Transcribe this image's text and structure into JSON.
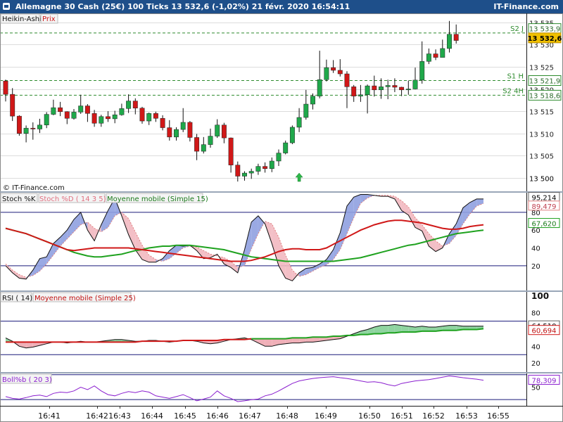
{
  "header": {
    "title": "Allemagne 30 Cash (25€)   100 Ticks   13 532,6 (-1,02%)   21 févr. 2020 16:54:11",
    "brand": "IT-Finance.com"
  },
  "watermark": "© IT-Finance.com",
  "colors": {
    "bull": "#1fa84a",
    "bear": "#d01818",
    "grid": "#dcdcdc",
    "sep": "#1a1a1a",
    "dash": "#2e8b2e",
    "k": "#111111",
    "d": "#e08080",
    "ma_stoch": "#1fa21f",
    "rsi": "#111111",
    "rsi_ma": "#d01818",
    "boll": "#8a1ecf",
    "fill_up": "#8fa0e0",
    "fill_down": "#f2b8c0",
    "fill_rsi_up": "#8fd4a0",
    "fill_rsi_down": "#f0b0b8",
    "hline": "#1a1a7a"
  },
  "chart_data": [
    {
      "type": "candlestick",
      "subtype": "heikin-ashi",
      "legend": [
        "Heikin-Ashi",
        "Prix"
      ],
      "ylim": [
        13497,
        13537
      ],
      "yticks": [
        13500,
        13505,
        13510,
        13515,
        13520,
        13525,
        13530,
        13535
      ],
      "xticks": [
        "16:41",
        "16:42",
        "16:43",
        "16:44",
        "16:45",
        "16:46",
        "16:47",
        "16:48",
        "16:49",
        "16:50",
        "16:51",
        "16:52",
        "16:53",
        "16:55"
      ],
      "levels": [
        {
          "label": "S2 J",
          "value": 13532.6
        },
        {
          "label": "S1 H",
          "value": 13521.9
        },
        {
          "label": "S2 4H",
          "value": 13518.6
        }
      ],
      "price_labels": [
        "13 533,9",
        "13 532,6",
        "13 521,9",
        "13 518,6"
      ],
      "signal": "buy-arrow",
      "candles": [
        [
          13521.8,
          13518.8,
          13522.1,
          13517.2
        ],
        [
          13518.8,
          13513.9,
          13520.2,
          13512.8
        ],
        [
          13513.9,
          13510.0,
          13514.1,
          13509.5
        ],
        [
          13510.0,
          13511.2,
          13511.8,
          13508.0
        ],
        [
          13511.2,
          13511.0,
          13512.5,
          13508.6
        ],
        [
          13511.0,
          13511.9,
          13513.3,
          13510.1
        ],
        [
          13511.9,
          13514.3,
          13514.8,
          13511.2
        ],
        [
          13514.3,
          13515.8,
          13517.6,
          13514.1
        ],
        [
          13515.8,
          13514.9,
          13517.1,
          13513.9
        ],
        [
          13514.9,
          13513.4,
          13515.0,
          13512.1
        ],
        [
          13513.4,
          13514.8,
          13515.5,
          13513.1
        ],
        [
          13514.8,
          13516.2,
          13518.7,
          13514.4
        ],
        [
          13516.2,
          13514.5,
          13516.6,
          13512.6
        ],
        [
          13514.5,
          13512.3,
          13515.3,
          13511.5
        ],
        [
          13512.3,
          13513.8,
          13514.2,
          13511.5
        ],
        [
          13513.8,
          13513.3,
          13515.0,
          13512.6
        ],
        [
          13513.3,
          13514.2,
          13515.1,
          13512.3
        ],
        [
          13514.2,
          13515.6,
          13516.7,
          13514.0
        ],
        [
          13515.6,
          13517.3,
          13518.8,
          13514.6
        ],
        [
          13517.3,
          13515.7,
          13517.9,
          13514.3
        ],
        [
          13515.7,
          13512.8,
          13516.0,
          13512.2
        ],
        [
          13512.8,
          13514.5,
          13514.7,
          13511.9
        ],
        [
          13514.5,
          13513.4,
          13514.9,
          13512.6
        ],
        [
          13513.4,
          13511.3,
          13514.1,
          13510.7
        ],
        [
          13511.3,
          13509.2,
          13513.0,
          13508.4
        ],
        [
          13509.2,
          13510.9,
          13511.4,
          13508.4
        ],
        [
          13510.9,
          13512.5,
          13515.7,
          13510.3
        ],
        [
          13512.5,
          13509.1,
          13512.8,
          13508.2
        ],
        [
          13509.1,
          13506.0,
          13509.9,
          13504.0
        ],
        [
          13506.0,
          13507.5,
          13509.2,
          13505.5
        ],
        [
          13507.5,
          13509.4,
          13511.1,
          13506.8
        ],
        [
          13509.4,
          13511.9,
          13513.2,
          13509.0
        ],
        [
          13511.9,
          13509.0,
          13512.4,
          13507.8
        ],
        [
          13509.0,
          13502.9,
          13509.1,
          13501.2
        ],
        [
          13502.9,
          13500.4,
          13503.7,
          13499.2
        ],
        [
          13500.4,
          13501.1,
          13501.5,
          13499.4
        ],
        [
          13501.1,
          13501.5,
          13502.1,
          13499.8
        ],
        [
          13501.5,
          13502.6,
          13503.2,
          13500.7
        ],
        [
          13502.6,
          13502.1,
          13503.5,
          13501.2
        ],
        [
          13502.1,
          13503.8,
          13504.6,
          13501.3
        ],
        [
          13503.8,
          13505.6,
          13506.4,
          13502.7
        ],
        [
          13505.6,
          13507.9,
          13508.4,
          13505.3
        ],
        [
          13507.9,
          13511.4,
          13511.8,
          13507.6
        ],
        [
          13511.4,
          13513.6,
          13515.7,
          13510.3
        ],
        [
          13513.6,
          13516.6,
          13519.8,
          13513.1
        ],
        [
          13516.6,
          13518.4,
          13519.0,
          13515.4
        ],
        [
          13518.4,
          13522.1,
          13528.6,
          13517.9
        ],
        [
          13522.1,
          13524.8,
          13526.6,
          13521.7
        ],
        [
          13524.8,
          13524.2,
          13526.5,
          13523.6
        ],
        [
          13524.2,
          13523.4,
          13526.7,
          13522.8
        ],
        [
          13523.4,
          13520.5,
          13524.0,
          13515.7
        ],
        [
          13520.5,
          13518.4,
          13520.9,
          13517.1
        ],
        [
          13518.4,
          13518.7,
          13520.9,
          13517.1
        ],
        [
          13518.7,
          13520.7,
          13521.0,
          13514.5
        ],
        [
          13520.7,
          13519.8,
          13523.0,
          13518.3
        ],
        [
          13519.8,
          13520.5,
          13522.4,
          13517.8
        ],
        [
          13520.5,
          13520.8,
          13522.1,
          13517.7
        ],
        [
          13520.8,
          13520.4,
          13522.4,
          13519.3
        ],
        [
          13520.4,
          13519.8,
          13520.5,
          13518.4
        ],
        [
          13519.8,
          13520.0,
          13521.9,
          13518.7
        ],
        [
          13520.0,
          13522.0,
          13524.8,
          13519.9
        ],
        [
          13522.0,
          13526.2,
          13530.7,
          13521.2
        ],
        [
          13526.2,
          13527.9,
          13529.1,
          13525.6
        ],
        [
          13527.9,
          13527.1,
          13528.9,
          13526.5
        ],
        [
          13527.1,
          13529.1,
          13531.1,
          13527.1
        ],
        [
          13529.1,
          13532.3,
          13535.3,
          13528.2
        ],
        [
          13532.3,
          13530.9,
          13534.5,
          13530.2
        ]
      ]
    },
    {
      "type": "line",
      "name": "stochastic",
      "legend": [
        "Stoch %K",
        "Stoch %D ( 14 3 5)",
        "Moyenne mobile (Simple 15)"
      ],
      "ylim": [
        -7,
        102
      ],
      "yticks": [
        20,
        40,
        60,
        80
      ],
      "hlines": [
        20,
        80
      ],
      "value_labels": [
        "95,214",
        "89,479",
        "67,620"
      ],
      "series": [
        {
          "name": "Stoch %K",
          "values": [
            20,
            12,
            6,
            5,
            15,
            28,
            30,
            45,
            52,
            60,
            72,
            80,
            60,
            48,
            66,
            82,
            96,
            76,
            55,
            38,
            27,
            24,
            24,
            28,
            37,
            43,
            42,
            43,
            37,
            28,
            29,
            33,
            22,
            18,
            12,
            38,
            69,
            76,
            67,
            45,
            20,
            6,
            3,
            12,
            17,
            18,
            22,
            27,
            38,
            57,
            87,
            97,
            100,
            100,
            99,
            98,
            98,
            95,
            82,
            77,
            63,
            59,
            42,
            36,
            40,
            56,
            67,
            85,
            91,
            95,
            95
          ]
        },
        {
          "name": "Stoch %D",
          "values": [
            22,
            15,
            10,
            7,
            9,
            14,
            22,
            32,
            42,
            50,
            58,
            66,
            69,
            62,
            58,
            63,
            76,
            80,
            73,
            58,
            43,
            32,
            27,
            25,
            28,
            34,
            40,
            42,
            41,
            37,
            33,
            31,
            29,
            25,
            18,
            20,
            39,
            56,
            70,
            67,
            52,
            32,
            15,
            8,
            10,
            14,
            18,
            21,
            27,
            38,
            56,
            74,
            90,
            96,
            99,
            99,
            99,
            98,
            93,
            86,
            74,
            66,
            56,
            48,
            42,
            45,
            54,
            67,
            78,
            87,
            90
          ]
        },
        {
          "name": "Moyenne mobile",
          "values": [
            62,
            60,
            58,
            56,
            53,
            50,
            47,
            44,
            41,
            38,
            35,
            33,
            31,
            30,
            30,
            31,
            32,
            33,
            35,
            37,
            38,
            40,
            41,
            42,
            42,
            43,
            43,
            43,
            42,
            41,
            40,
            39,
            38,
            36,
            34,
            32,
            30,
            29,
            28,
            27,
            26,
            25,
            25,
            25,
            25,
            25,
            25,
            25,
            25,
            26,
            27,
            28,
            29,
            31,
            33,
            35,
            37,
            39,
            41,
            43,
            44,
            46,
            48,
            50,
            52,
            54,
            56,
            57,
            58,
            59,
            60
          ]
        }
      ]
    },
    {
      "type": "line",
      "name": "rsi",
      "legend": [
        "RSI ( 14)",
        "Moyenne mobile (Simple 25)"
      ],
      "ylim": [
        10,
        105
      ],
      "yticks": [
        20,
        40,
        60,
        80,
        100
      ],
      "hlines": [
        30,
        70
      ],
      "value_labels": [
        "64,510",
        "60,694"
      ],
      "series": [
        {
          "name": "RSI",
          "values": [
            50,
            46,
            40,
            38,
            39,
            41,
            43,
            45,
            45,
            44,
            45,
            46,
            45,
            45,
            46,
            47,
            48,
            48,
            47,
            46,
            46,
            47,
            47,
            46,
            45,
            46,
            47,
            47,
            46,
            44,
            43,
            44,
            46,
            48,
            49,
            50,
            48,
            44,
            40,
            40,
            42,
            43,
            44,
            44,
            45,
            45,
            46,
            47,
            48,
            49,
            52,
            55,
            58,
            60,
            63,
            65,
            65,
            66,
            65,
            64,
            63,
            64,
            63,
            63,
            64,
            65,
            65,
            64,
            64,
            64,
            64
          ]
        },
        {
          "name": "RSI MA",
          "values": [
            45,
            45,
            45,
            45,
            45,
            45,
            45,
            45,
            45,
            45,
            45,
            45,
            45,
            45,
            45,
            45,
            45,
            45,
            45,
            45,
            46,
            46,
            46,
            46,
            46,
            46,
            47,
            47,
            47,
            47,
            47,
            47,
            48,
            48,
            48,
            48,
            49,
            49,
            49,
            49,
            49,
            49,
            50,
            50,
            50,
            51,
            51,
            51,
            52,
            52,
            53,
            53,
            54,
            54,
            55,
            55,
            56,
            56,
            57,
            57,
            57,
            58,
            58,
            58,
            59,
            59,
            59,
            60,
            60,
            60,
            61
          ]
        }
      ]
    },
    {
      "type": "line",
      "name": "boll",
      "legend": [
        "Boll%b ( 20 3)"
      ],
      "ylim": [
        -25,
        105
      ],
      "yticks": [
        50
      ],
      "hlines": [
        0,
        100
      ],
      "value_labels": [
        "78,309"
      ],
      "series": [
        {
          "name": "Boll%b",
          "values": [
            12,
            5,
            2,
            8,
            15,
            18,
            12,
            25,
            30,
            28,
            35,
            50,
            40,
            55,
            35,
            20,
            15,
            25,
            32,
            28,
            35,
            30,
            15,
            10,
            5,
            12,
            20,
            8,
            -5,
            2,
            10,
            35,
            15,
            5,
            -8,
            -5,
            0,
            2,
            15,
            22,
            35,
            50,
            65,
            75,
            80,
            85,
            88,
            90,
            92,
            88,
            85,
            80,
            75,
            70,
            72,
            68,
            60,
            55,
            65,
            70,
            75,
            78,
            80,
            85,
            90,
            95,
            92,
            88,
            85,
            82,
            78
          ]
        }
      ]
    }
  ]
}
